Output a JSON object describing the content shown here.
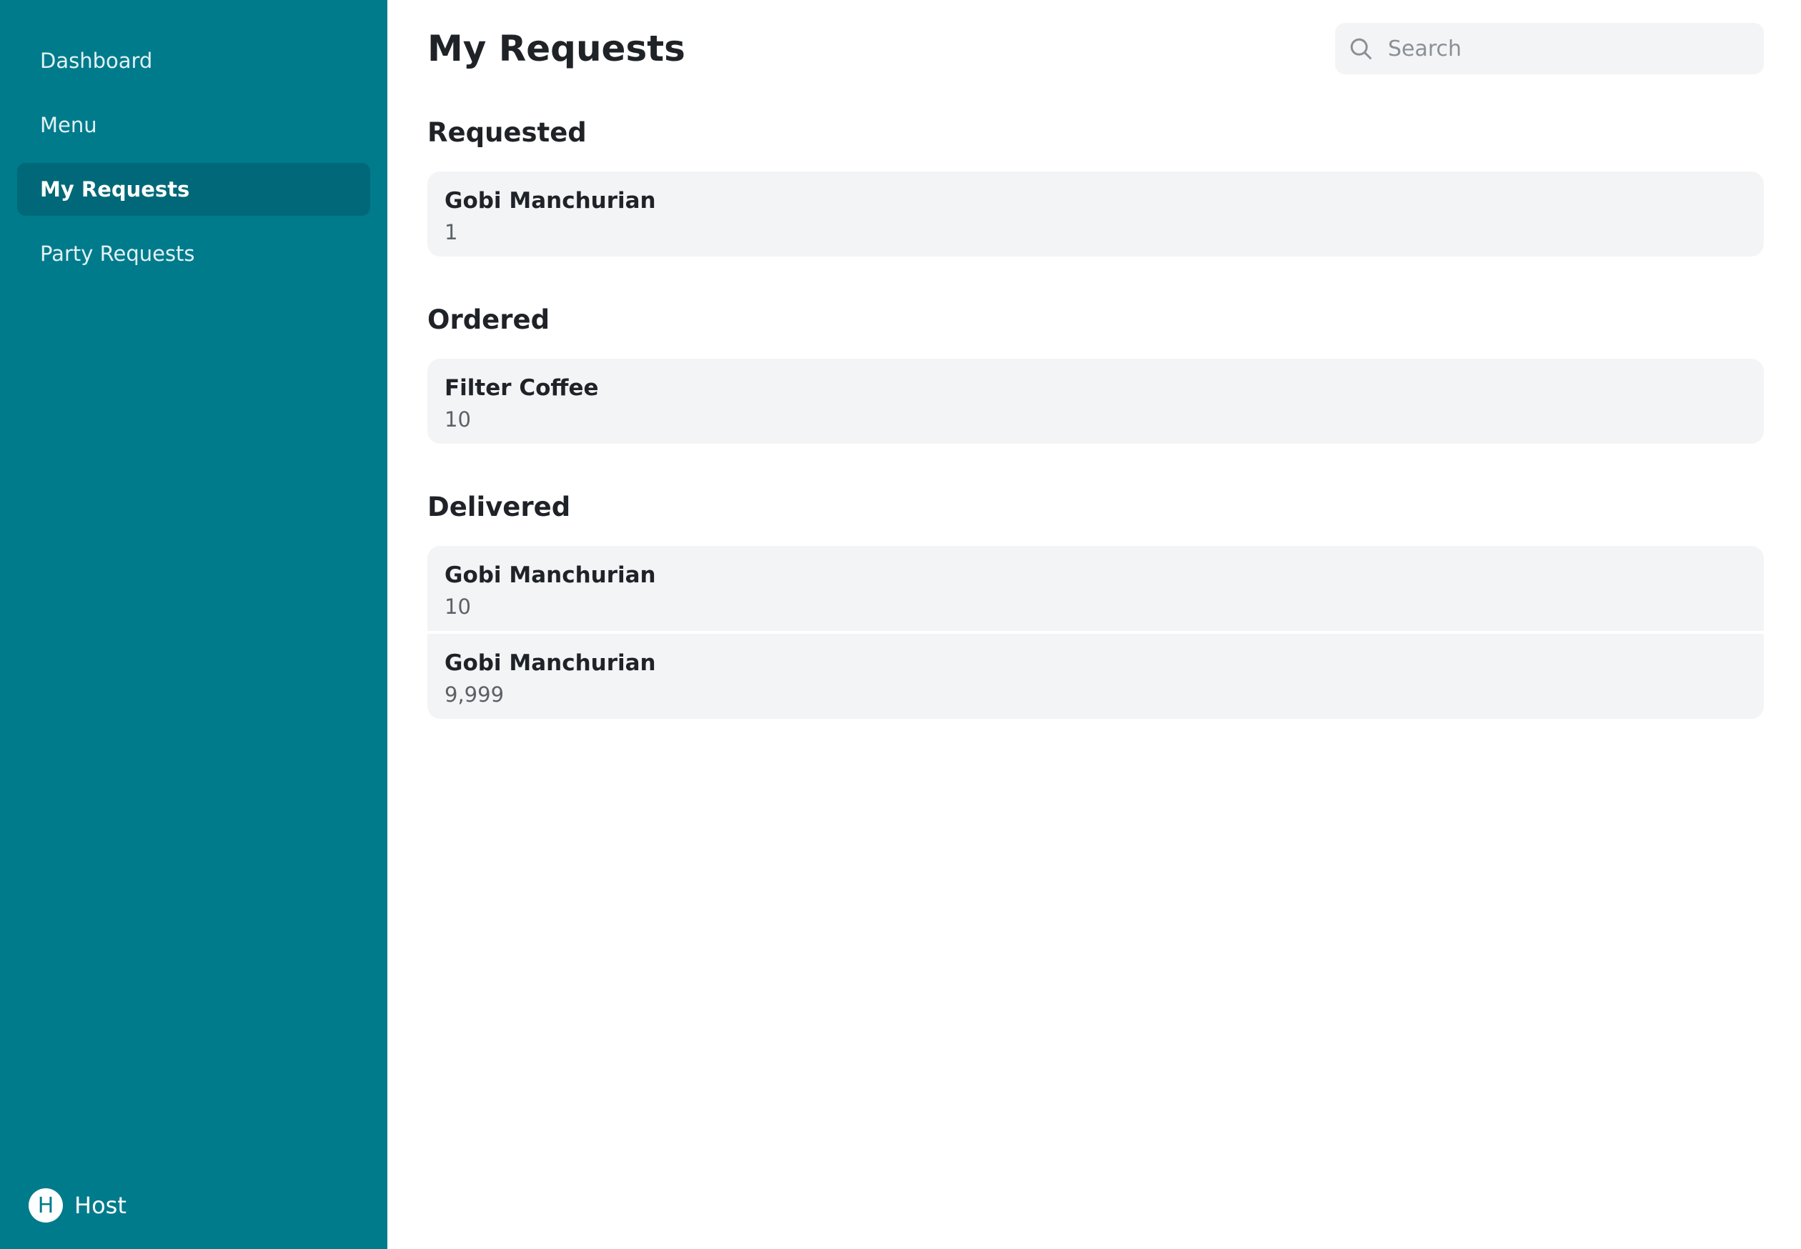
{
  "sidebar": {
    "items": [
      {
        "label": "Dashboard",
        "active": false
      },
      {
        "label": "Menu",
        "active": false
      },
      {
        "label": "My Requests",
        "active": true
      },
      {
        "label": "Party Requests",
        "active": false
      }
    ],
    "user": {
      "initial": "H",
      "name": "Host"
    }
  },
  "header": {
    "title": "My Requests",
    "search_placeholder": "Search"
  },
  "sections": [
    {
      "title": "Requested",
      "items": [
        {
          "name": "Gobi Manchurian",
          "quantity": "1"
        }
      ]
    },
    {
      "title": "Ordered",
      "items": [
        {
          "name": "Filter Coffee",
          "quantity": "10"
        }
      ]
    },
    {
      "title": "Delivered",
      "items": [
        {
          "name": "Gobi Manchurian",
          "quantity": "10"
        },
        {
          "name": "Gobi Manchurian",
          "quantity": "9,999"
        }
      ]
    }
  ],
  "colors": {
    "sidebar_bg": "#007b8c",
    "sidebar_active_bg": "#006878",
    "card_bg": "#f3f4f6"
  }
}
